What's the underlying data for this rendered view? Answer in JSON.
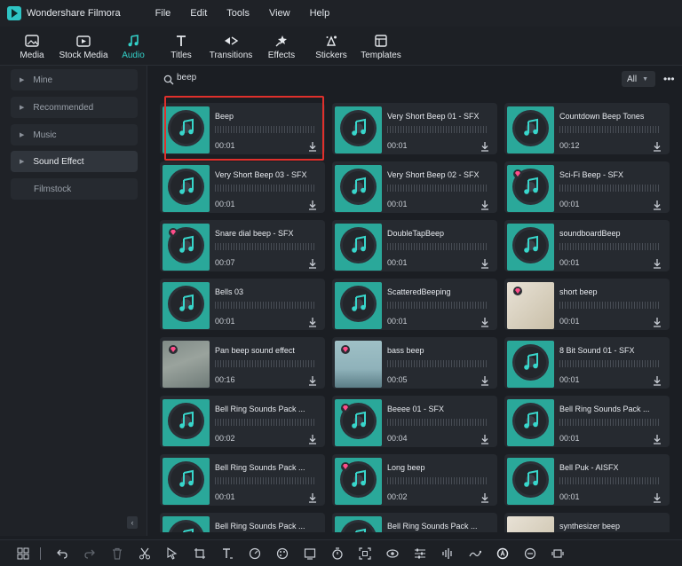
{
  "app": {
    "title": "Wondershare Filmora",
    "menu": [
      "File",
      "Edit",
      "Tools",
      "View",
      "Help"
    ]
  },
  "toolbar": {
    "tabs": [
      {
        "label": "Media",
        "icon": "media-icon"
      },
      {
        "label": "Stock Media",
        "icon": "stock-media-icon"
      },
      {
        "label": "Audio",
        "icon": "music-note-icon",
        "active": true
      },
      {
        "label": "Titles",
        "icon": "titles-icon"
      },
      {
        "label": "Transitions",
        "icon": "transitions-icon"
      },
      {
        "label": "Effects",
        "icon": "effects-icon"
      },
      {
        "label": "Stickers",
        "icon": "stickers-icon"
      },
      {
        "label": "Templates",
        "icon": "templates-icon"
      }
    ]
  },
  "sidebar": {
    "items": [
      {
        "label": "Mine",
        "expandable": true
      },
      {
        "label": "Recommended",
        "expandable": true
      },
      {
        "label": "Music",
        "expandable": true
      },
      {
        "label": "Sound Effect",
        "expandable": true,
        "active": true
      },
      {
        "label": "Filmstock",
        "expandable": false
      }
    ]
  },
  "search": {
    "value": "beep",
    "filter": "All"
  },
  "results": [
    {
      "name": "Beep",
      "duration": "00:01",
      "thumb": "disc",
      "premium": false,
      "selected": true
    },
    {
      "name": "Very Short Beep 01 - SFX",
      "duration": "00:01",
      "thumb": "disc",
      "premium": false
    },
    {
      "name": "Countdown Beep Tones",
      "duration": "00:12",
      "thumb": "disc",
      "premium": false
    },
    {
      "name": "Very Short Beep 03 - SFX",
      "duration": "00:01",
      "thumb": "disc",
      "premium": false
    },
    {
      "name": "Very Short Beep 02 - SFX",
      "duration": "00:01",
      "thumb": "disc",
      "premium": false
    },
    {
      "name": "Sci-Fi Beep - SFX",
      "duration": "00:01",
      "thumb": "disc",
      "premium": true
    },
    {
      "name": "Snare dial beep - SFX",
      "duration": "00:07",
      "thumb": "disc",
      "premium": true
    },
    {
      "name": "DoubleTapBeep",
      "duration": "00:01",
      "thumb": "disc",
      "premium": false
    },
    {
      "name": "soundboardBeep",
      "duration": "00:01",
      "thumb": "disc",
      "premium": false
    },
    {
      "name": "Bells 03",
      "duration": "00:01",
      "thumb": "disc",
      "premium": false
    },
    {
      "name": "ScatteredBeeping",
      "duration": "00:01",
      "thumb": "disc",
      "premium": false
    },
    {
      "name": "short beep",
      "duration": "00:01",
      "thumb": "photo1",
      "premium": true
    },
    {
      "name": "Pan beep sound effect",
      "duration": "00:16",
      "thumb": "photo2",
      "premium": true
    },
    {
      "name": "bass beep",
      "duration": "00:05",
      "thumb": "photo3",
      "premium": true
    },
    {
      "name": "8 Bit Sound 01 - SFX",
      "duration": "00:01",
      "thumb": "disc",
      "premium": false
    },
    {
      "name": "Bell Ring Sounds Pack ...",
      "duration": "00:02",
      "thumb": "disc",
      "premium": false
    },
    {
      "name": "Beeee 01 - SFX",
      "duration": "00:04",
      "thumb": "disc",
      "premium": true
    },
    {
      "name": "Bell Ring Sounds Pack ...",
      "duration": "00:01",
      "thumb": "disc",
      "premium": false
    },
    {
      "name": "Bell Ring Sounds Pack ...",
      "duration": "00:01",
      "thumb": "disc",
      "premium": false
    },
    {
      "name": "Long beep",
      "duration": "00:02",
      "thumb": "disc",
      "premium": true
    },
    {
      "name": "Bell Puk - AISFX",
      "duration": "00:01",
      "thumb": "disc",
      "premium": false
    },
    {
      "name": "Bell Ring Sounds Pack ...",
      "duration": "",
      "thumb": "disc",
      "premium": false
    },
    {
      "name": "Bell Ring Sounds Pack ...",
      "duration": "",
      "thumb": "disc",
      "premium": false
    },
    {
      "name": "synthesizer beep",
      "duration": "",
      "thumb": "photo1",
      "premium": false
    }
  ],
  "bottom_tools": [
    "layout-icon",
    "undo-icon",
    "redo-icon",
    "delete-icon",
    "cut-icon",
    "select-arrow-icon",
    "crop-icon",
    "text-icon",
    "speed-icon",
    "color-icon",
    "freeze-frame-icon",
    "timer-icon",
    "screen-icon",
    "mask-icon",
    "adjust-icon",
    "audio-mix-icon",
    "motion-icon",
    "ai-icon",
    "effect-icon",
    "trim-icon"
  ],
  "colors": {
    "accent": "#33d1c9",
    "highlight": "#e0302c",
    "premium": "#ff4d8a"
  }
}
